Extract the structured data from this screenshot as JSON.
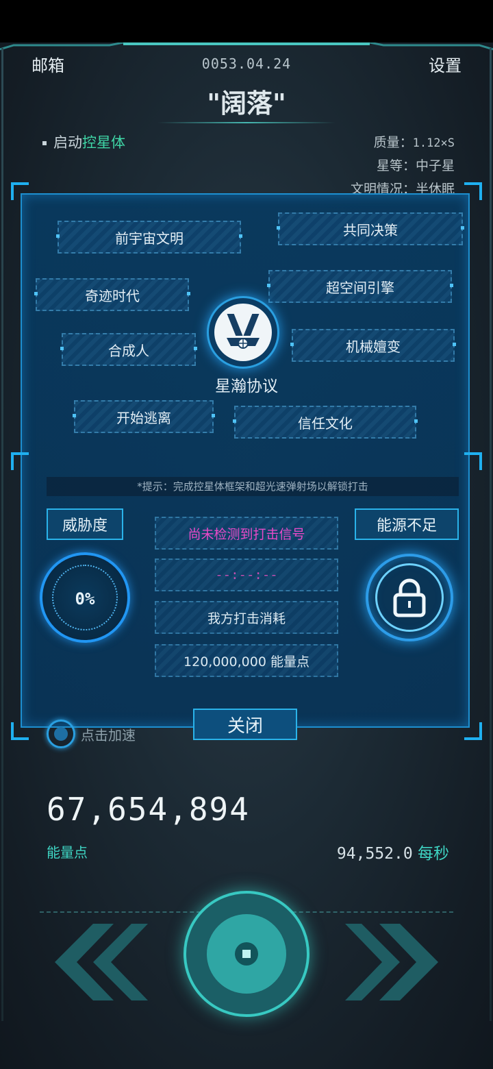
{
  "header": {
    "mail_label": "邮箱",
    "date": "0053.04.24",
    "settings_label": "设置",
    "title": "\"阔落\"",
    "launch_prefix": "启动",
    "launch_highlight": "控星体"
  },
  "star_info": {
    "mass_label": "质量：",
    "mass_value": "1.12×S",
    "grade": "星等：中子星",
    "civ_status": "文明情况：半休眠"
  },
  "techs": [
    {
      "label": "前宇宙文明"
    },
    {
      "label": "共同决策"
    },
    {
      "label": "奇迹时代"
    },
    {
      "label": "超空间引擎"
    },
    {
      "label": "合成人"
    },
    {
      "label": "机械嬗变"
    },
    {
      "label": "开始逃离"
    },
    {
      "label": "信任文化"
    }
  ],
  "emblem_label": "星瀚协议",
  "strike": {
    "hint": "*提示：完成控星体框架和超光速弹射场以解锁打击",
    "threat_label": "威胁度",
    "threat_value": "0%",
    "energy_status": "能源不足",
    "signal": "尚未检测到打击信号",
    "countdown": "--:--:--",
    "cost_label": "我方打击消耗",
    "cost_value": "120,000,000 能量点",
    "close_label": "关闭"
  },
  "speedup_label": "点击加速",
  "energy": {
    "total": "67,654,894",
    "label": "能量点",
    "rate": "94,552.0",
    "rate_unit": "每秒"
  },
  "colors": {
    "accent": "#2ab3ea",
    "teal": "#3fd6c4",
    "signal": "#e84ac8"
  }
}
